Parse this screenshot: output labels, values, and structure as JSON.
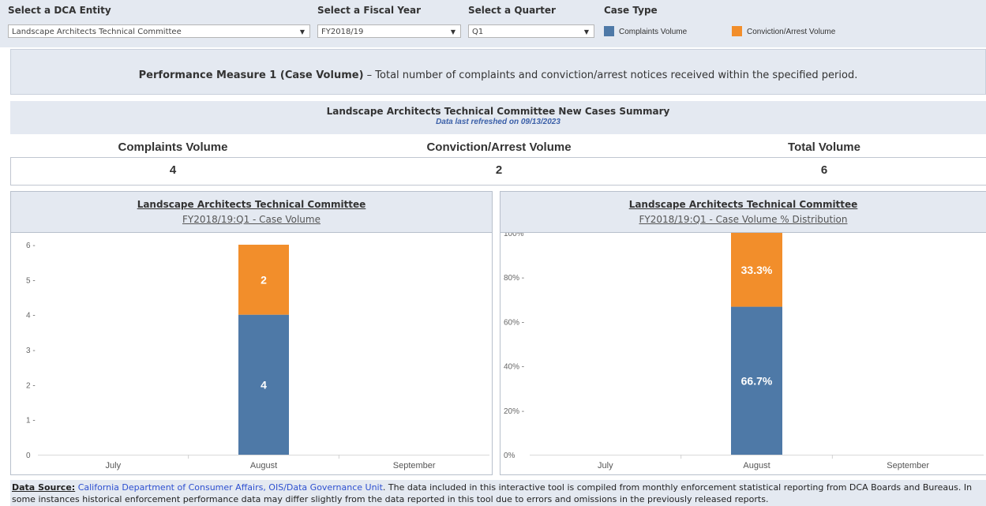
{
  "filters": {
    "entity": {
      "label": "Select a DCA Entity",
      "value": "Landscape Architects Technical Committee"
    },
    "fiscal_year": {
      "label": "Select a Fiscal Year",
      "value": "FY2018/19"
    },
    "quarter": {
      "label": "Select a Quarter",
      "value": "Q1"
    },
    "case_type": {
      "label": "Case Type",
      "items": [
        {
          "label": "Complaints Volume",
          "color": "#4e79a7"
        },
        {
          "label": "Conviction/Arrest Volume",
          "color": "#f28e2b"
        }
      ]
    }
  },
  "performance_measure": {
    "title": "Performance Measure 1 (Case Volume)",
    "description": " – Total number of complaints and conviction/arrest notices received within the specified period."
  },
  "summary": {
    "title": "Landscape Architects Technical Committee New Cases Summary",
    "refreshed": "Data last refreshed on 09/13/2023",
    "metrics": [
      {
        "label": "Complaints Volume",
        "value": "4"
      },
      {
        "label": "Conviction/Arrest Volume",
        "value": "2"
      },
      {
        "label": "Total Volume",
        "value": "6"
      }
    ]
  },
  "panels": [
    {
      "title": "Landscape Architects Technical Committee",
      "subtitle": "FY2018/19:Q1  - Case Volume"
    },
    {
      "title": "Landscape Architects Technical Committee",
      "subtitle": "FY2018/19:Q1  - Case Volume % Distribution"
    }
  ],
  "chart_data": [
    {
      "type": "bar",
      "stacked": true,
      "categories": [
        "July",
        "August",
        "September"
      ],
      "series": [
        {
          "name": "Complaints Volume",
          "color": "#4e79a7",
          "values": [
            0,
            4,
            0
          ],
          "labels": [
            "",
            "4",
            ""
          ]
        },
        {
          "name": "Conviction/Arrest Volume",
          "color": "#f28e2b",
          "values": [
            0,
            2,
            0
          ],
          "labels": [
            "",
            "2",
            ""
          ]
        }
      ],
      "ylim": [
        0,
        6
      ],
      "yticks": [
        "0",
        "1 -",
        "2 -",
        "3 -",
        "4 -",
        "5 -",
        "6 -"
      ],
      "grid": false
    },
    {
      "type": "bar",
      "stacked": true,
      "categories": [
        "July",
        "August",
        "September"
      ],
      "series": [
        {
          "name": "Complaints Volume",
          "color": "#4e79a7",
          "values": [
            0,
            66.7,
            0
          ],
          "labels": [
            "",
            "66.7%",
            ""
          ]
        },
        {
          "name": "Conviction/Arrest Volume",
          "color": "#f28e2b",
          "values": [
            0,
            33.3,
            0
          ],
          "labels": [
            "",
            "33.3%",
            ""
          ]
        }
      ],
      "ylim": [
        0,
        100
      ],
      "yticks": [
        "0%",
        "20% -",
        "40% -",
        "60% -",
        "80% -",
        "100%"
      ],
      "grid": false
    }
  ],
  "footer": {
    "heading": "Data Source:",
    "link": "California Department of Consumer Affairs, OIS/Data Governance Unit",
    "text": ".  The data included in this interactive tool is compiled from monthly enforcement statistical reporting from DCA Boards and Bureaus.  In some instances historical enforcement performance data may differ slightly from the data reported in this tool due to errors and omissions in the previously released reports."
  }
}
